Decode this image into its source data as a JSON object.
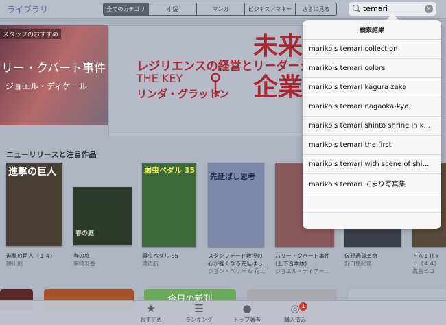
{
  "nav": {
    "back_label": "ライブラリ",
    "segments": [
      "全てのカテゴリ",
      "小説",
      "マンガ",
      "ビジネス／マネー",
      "さらに見る"
    ],
    "search_query": "temari"
  },
  "banners": {
    "left_tag": "スタッフのおすすめ",
    "left_title": "リー・クバート事件",
    "left_author": "ジョエル・ディケール",
    "main_line1": "レジリエンスの経営とリーダーシップ",
    "main_line2": "THE KEY",
    "main_line3": "リンダ・グラットン",
    "main_big1": "未来",
    "main_big2": "企業"
  },
  "section": {
    "title": "ニューリリースと注目作品"
  },
  "books": [
    {
      "cover_text": "進撃の巨人",
      "title1": "進撃の巨人（１４）",
      "title2": "",
      "author": "諫山創",
      "color": "#4a4136"
    },
    {
      "cover_text": "春の庭",
      "title1": "春の庭",
      "title2": "",
      "author": "柴崎友香",
      "color": "#2c3a2a"
    },
    {
      "cover_text": "弱虫ペダル 35",
      "title1": "弱虫ペダル 35",
      "title2": "",
      "author": "渡辺航",
      "color": "#3a6a3a"
    },
    {
      "cover_text": "先延ばし思考",
      "title1": "スタンフォード教授の",
      "title2": "心が軽くなる先延ばし…",
      "author": "ジョン・ペリー & 花…",
      "color": "#7a8aa6"
    },
    {
      "cover_text": "",
      "title1": "ハリー・クバート事件",
      "title2": "(上下合本版)",
      "author": "ジョエル・ディケー…",
      "color": "#8a5a5a"
    },
    {
      "cover_text": "",
      "title1": "仮想通貨革命",
      "title2": "",
      "author": "野口悠紀雄",
      "color": "#3a3e4a"
    },
    {
      "cover_text": "",
      "title1": "ＦＡＩＲＹ",
      "title2": "Ｌ（４４）",
      "author": "真島ヒロ",
      "color": "#5a4a3a"
    }
  ],
  "bottom": {
    "card_label": "今日の新刊"
  },
  "tabs": [
    {
      "label": "おすすめ",
      "icon": "star-icon"
    },
    {
      "label": "ランキング",
      "icon": "list-icon"
    },
    {
      "label": "トップ著者",
      "icon": "people-icon"
    },
    {
      "label": "購入済み",
      "icon": "purchased-icon",
      "badge": "1"
    }
  ],
  "popover": {
    "header": "検索結果",
    "results": [
      "mariko's temari collection",
      "mariko's temari colors",
      "mariko's temari kagura zaka",
      "mariko's temari nagaoka-kyo",
      "mariko's temari shinto shrine in k…",
      "mariko's temari the first",
      "mariko's temari with scene of shi…",
      "mariko's temari てまり写真集"
    ]
  }
}
